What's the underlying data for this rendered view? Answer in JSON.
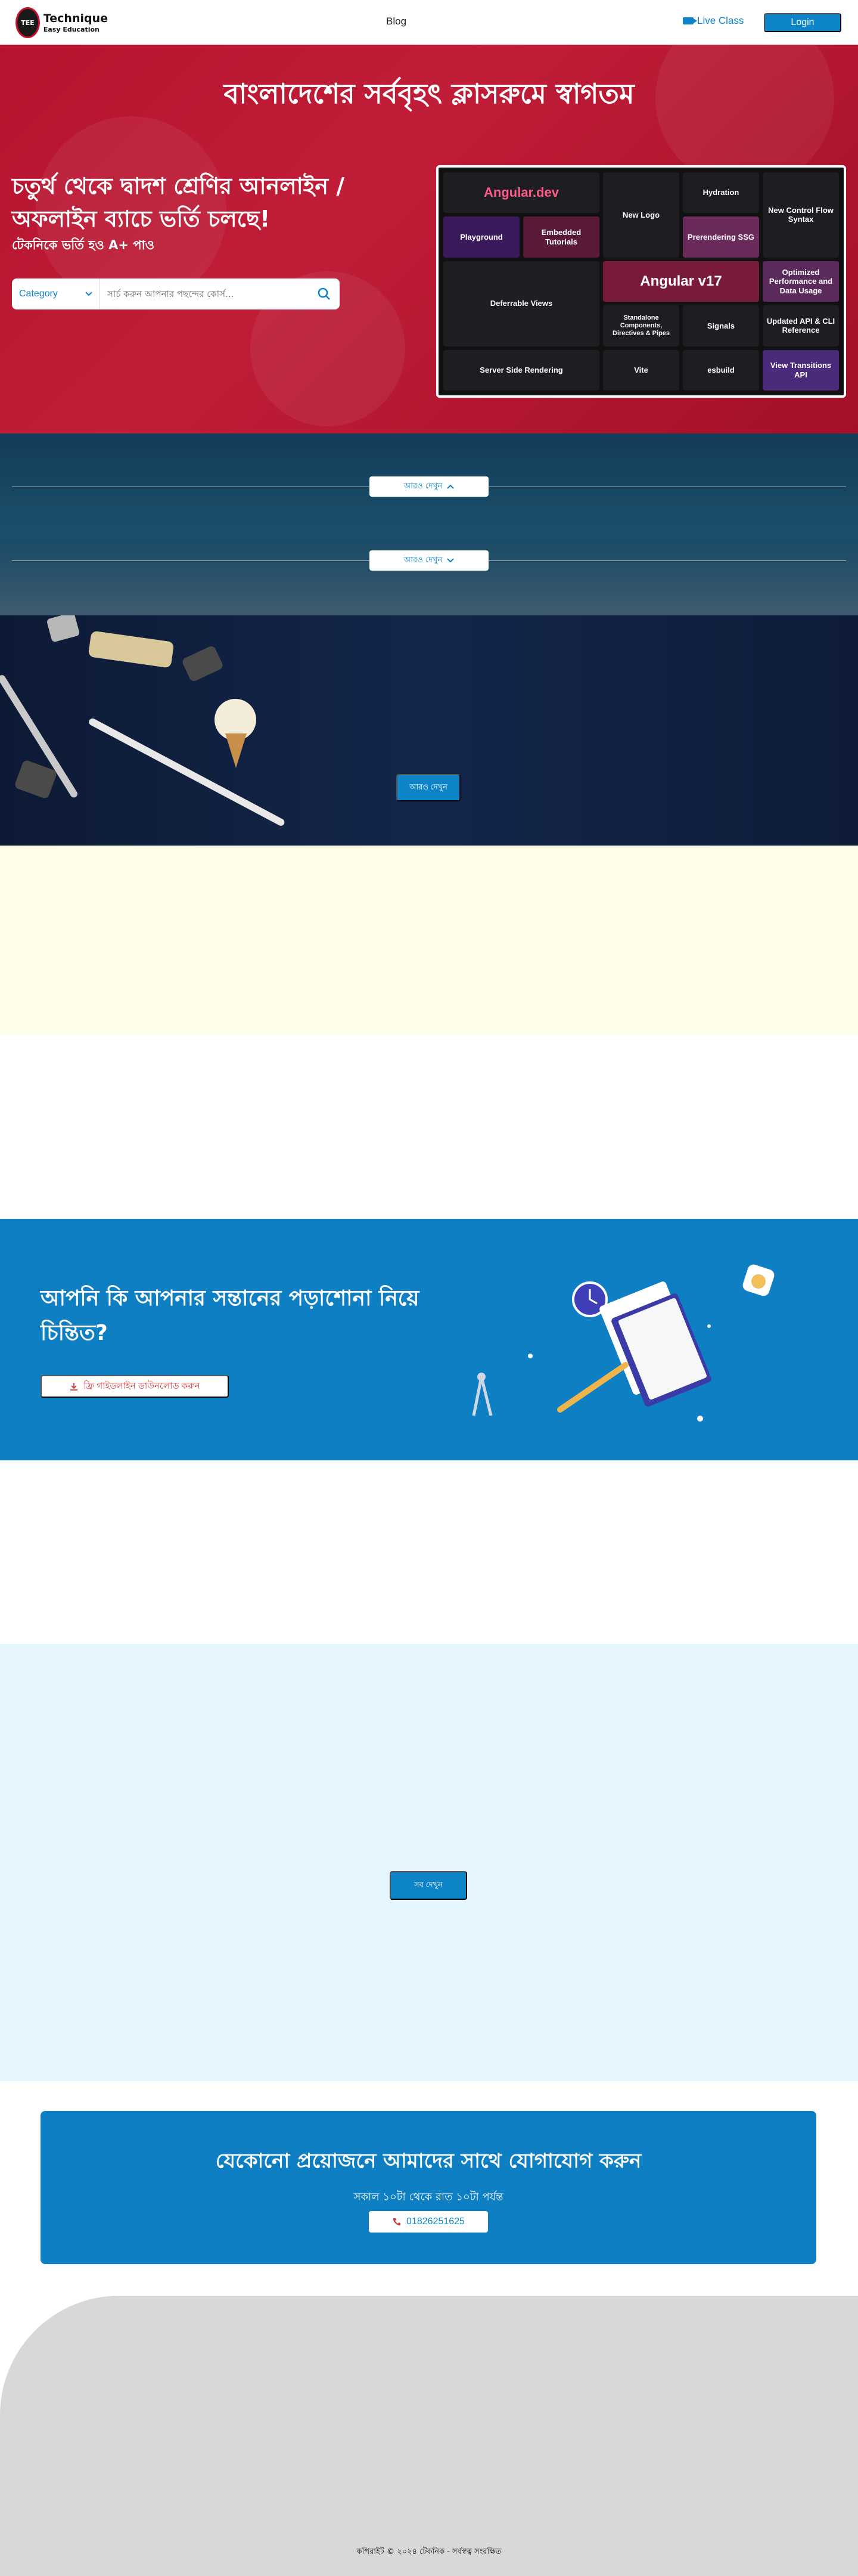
{
  "header": {
    "logo_title": "Technique",
    "logo_sub": "Easy Education",
    "nav_blog": "Blog",
    "live_class": "Live Class",
    "login": "Login"
  },
  "hero": {
    "title": "বাংলাদেশের সর্ববৃহৎ ক্লাসরুমে স্বাগতম",
    "heading": "চতুর্থ থেকে দ্বাদশ শ্রেণির আনলাইন / অফলাইন ব্যাচে ভর্তি চলছে!",
    "subheading": "টেকনিকে ভর্তি হও A+ পাও",
    "category_label": "Category",
    "search_placeholder": "সার্চ করুন আপনার পছন্দের কোর্স..."
  },
  "hero_image_tiles": [
    "Angular.dev",
    "New Logo",
    "Hydration",
    "New Control Flow Syntax",
    "Playground",
    "Embedded Tutorials",
    "Prerendering SSG",
    "Deferrable Views",
    "Angular v17",
    "Optimized Performance and Data Usage",
    "Signals",
    "Updated API & CLI Reference",
    "Server Side Rendering",
    "Standalone Components, Directives & Pipes",
    "Vite",
    "esbuild",
    "View Transitions API"
  ],
  "sky": {
    "pill_top": "আরও দেখুন",
    "pill_bottom": "আরও দেখুন"
  },
  "desk": {
    "button": "আরও দেখুন"
  },
  "blue_banner": {
    "heading": "আপনি কি আপনার সন্তানের পড়াশোনা নিয়ে চিন্তিত?",
    "button": "ফ্রি গাইডলাইন ডাউনলোড করুন"
  },
  "light_blue": {
    "button": "সব দেখুন"
  },
  "contact": {
    "title": "যেকোনো প্রয়োজনে আমাদের সাথে যোগাযোগ করুন",
    "subtitle": "সকাল ১০টা থেকে রাত ১০টা পর্যন্ত",
    "phone": "01826251625"
  },
  "footer": {
    "copyright": "কপিরাইট © ২০২৪ টেকনিক - সর্বস্বত্ব সংরক্ষিত"
  },
  "colors": {
    "brand_blue": "#0d84c7",
    "hero_red": "#b5132f"
  }
}
